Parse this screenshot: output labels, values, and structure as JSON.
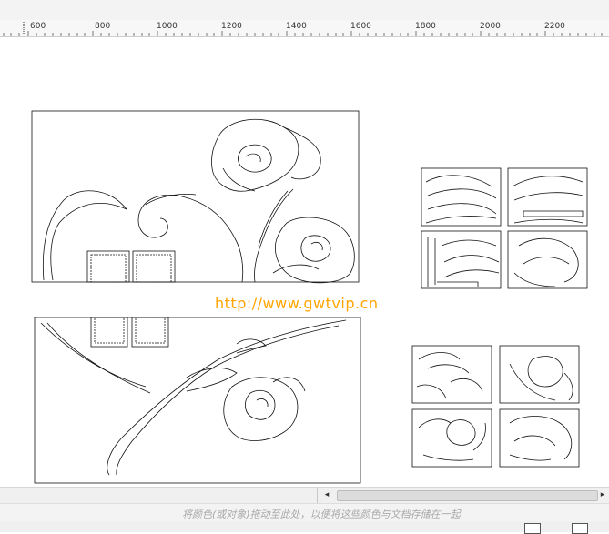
{
  "ruler": {
    "labels": [
      "600",
      "800",
      "1000",
      "1200",
      "1400",
      "1600",
      "1800",
      "2000",
      "2200"
    ]
  },
  "canvas": {
    "watermark": "http://www.gwtvip.cn"
  },
  "scrollbar": {
    "left_arrow": "◂",
    "right_arrow": "▸"
  },
  "color_hint": "将颜色(或对象)拖动至此处，以便将这些颜色与文档存储在一起",
  "icons": [
    "ruler-origin-icon",
    "scroll-left-icon",
    "scroll-right-icon",
    "page-view-icon",
    "fullscreen-icon"
  ]
}
